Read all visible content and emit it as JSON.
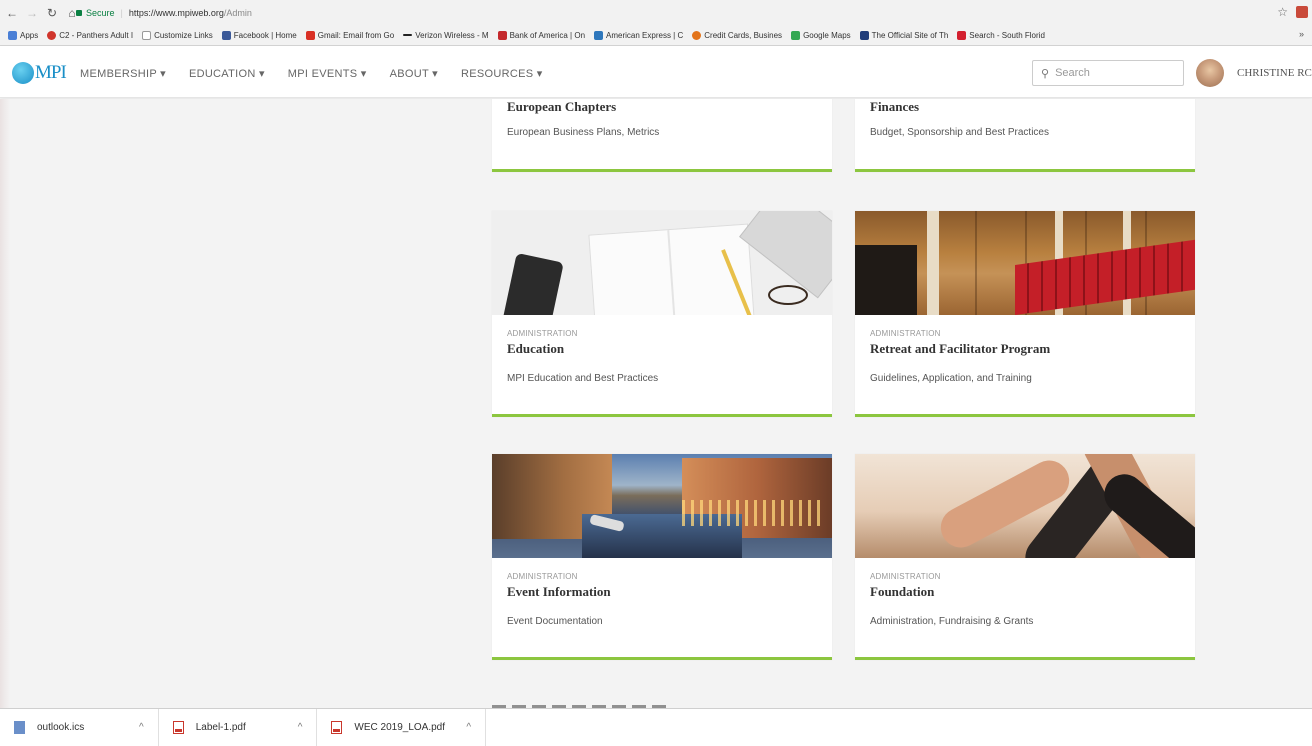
{
  "browser": {
    "secure_label": "Secure",
    "url_host": "https://www.mpiweb.org",
    "url_path": "/Admin",
    "bookmarks": [
      {
        "label": "Apps",
        "color": "#4a7fd6"
      },
      {
        "label": "C2 - Panthers Adult I",
        "color": "#d0352c"
      },
      {
        "label": "Customize Links",
        "color": "#999999"
      },
      {
        "label": "Facebook | Home",
        "color": "#3b5998"
      },
      {
        "label": "Gmail: Email from Go",
        "color": "#d93025"
      },
      {
        "label": "Verizon Wireless - M",
        "color": "#222222"
      },
      {
        "label": "Bank of America | On",
        "color": "#c4282c"
      },
      {
        "label": "American Express | C",
        "color": "#2e77bc"
      },
      {
        "label": "Credit Cards, Busines",
        "color": "#e3741b"
      },
      {
        "label": "Google Maps",
        "color": "#34a853"
      },
      {
        "label": "The Official Site of Th",
        "color": "#1f3c7a"
      },
      {
        "label": "Search - South Florid",
        "color": "#d3202f"
      }
    ],
    "more_label": "»"
  },
  "site": {
    "logo_text": "MPI",
    "nav": [
      "MEMBERSHIP ▾",
      "EDUCATION ▾",
      "MPI EVENTS ▾",
      "ABOUT ▾",
      "RESOURCES ▾"
    ],
    "search_placeholder": "Search",
    "user_name": "CHRISTINE RC"
  },
  "cards": {
    "european": {
      "title": "European Chapters",
      "desc": "European Business Plans, Metrics"
    },
    "finances": {
      "title": "Finances",
      "desc": "Budget, Sponsorship and Best Practices"
    },
    "education": {
      "category": "ADMINISTRATION",
      "title": "Education",
      "desc": "MPI Education and Best Practices"
    },
    "retreat": {
      "category": "ADMINISTRATION",
      "title": "Retreat and Facilitator Program",
      "desc": "Guidelines, Application, and Training"
    },
    "event_info": {
      "category": "ADMINISTRATION",
      "title": "Event Information",
      "desc": "Event Documentation"
    },
    "foundation": {
      "category": "ADMINISTRATION",
      "title": "Foundation",
      "desc": "Administration, Fundraising & Grants"
    }
  },
  "accent_color": "#8cc63f",
  "brand_color": "#1a8fc7",
  "downloads": [
    {
      "name": "outlook.ics",
      "icon": "ics-file-icon"
    },
    {
      "name": "Label-1.pdf",
      "icon": "pdf-file-icon"
    },
    {
      "name": "WEC 2019_LOA.pdf",
      "icon": "pdf-file-icon"
    }
  ]
}
